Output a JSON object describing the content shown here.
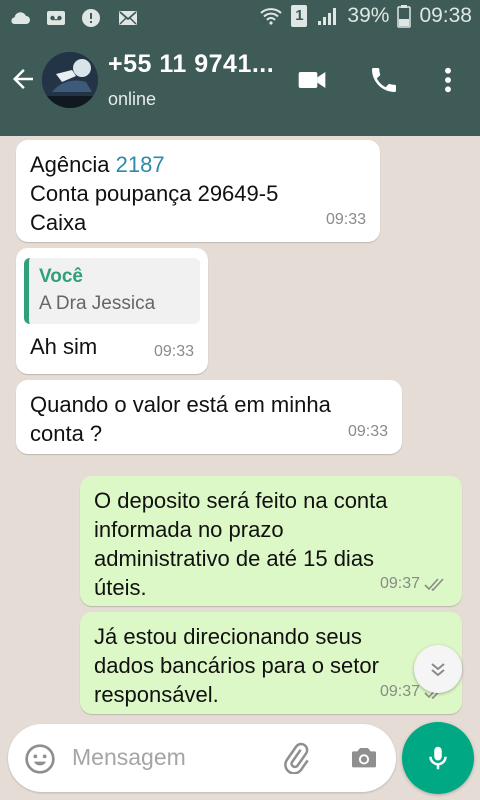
{
  "status_bar": {
    "battery": "39%",
    "time": "09:38",
    "sim_badge": "1",
    "icons": [
      "cloud-icon",
      "voicemail-icon",
      "alert-icon",
      "mail-icon",
      "wifi-icon",
      "sim-icon",
      "signal-icon",
      "battery-icon"
    ]
  },
  "header": {
    "name": "+55 11 9741...",
    "status": "online",
    "icons": [
      "back-arrow-icon",
      "video-call-icon",
      "phone-icon",
      "more-vert-icon"
    ]
  },
  "messages": [
    {
      "direction": "in",
      "lines": [
        "Agência ",
        "2187",
        "Conta poupança 29649-5",
        "Caixa"
      ],
      "time": "09:33"
    },
    {
      "direction": "in",
      "quote_author": "Você",
      "quote_text": "A Dra Jessica",
      "text": "Ah sim",
      "time": "09:33"
    },
    {
      "direction": "in",
      "text1": "Quando o valor está em minha",
      "text2": "conta ?",
      "time": "09:33"
    },
    {
      "direction": "out",
      "l1": "O deposito será feito na conta",
      "l2": "informada no prazo",
      "l3": "administrativo de até 15 dias",
      "l4": "úteis.",
      "time": "09:37",
      "read": true
    },
    {
      "direction": "out",
      "l1": "Já estou direcionando seus",
      "l2": "dados bancários para o setor",
      "l3": "responsável.",
      "time": "09:37",
      "read": true
    }
  ],
  "composer": {
    "placeholder": "Mensagem"
  },
  "colors": {
    "header": "#3e5b57",
    "chat_bg": "#e5ddd5",
    "outgoing": "#dcf8c6",
    "accent": "#00a884",
    "link": "#2e8aa8",
    "read_tick": "#8a8a8a"
  }
}
